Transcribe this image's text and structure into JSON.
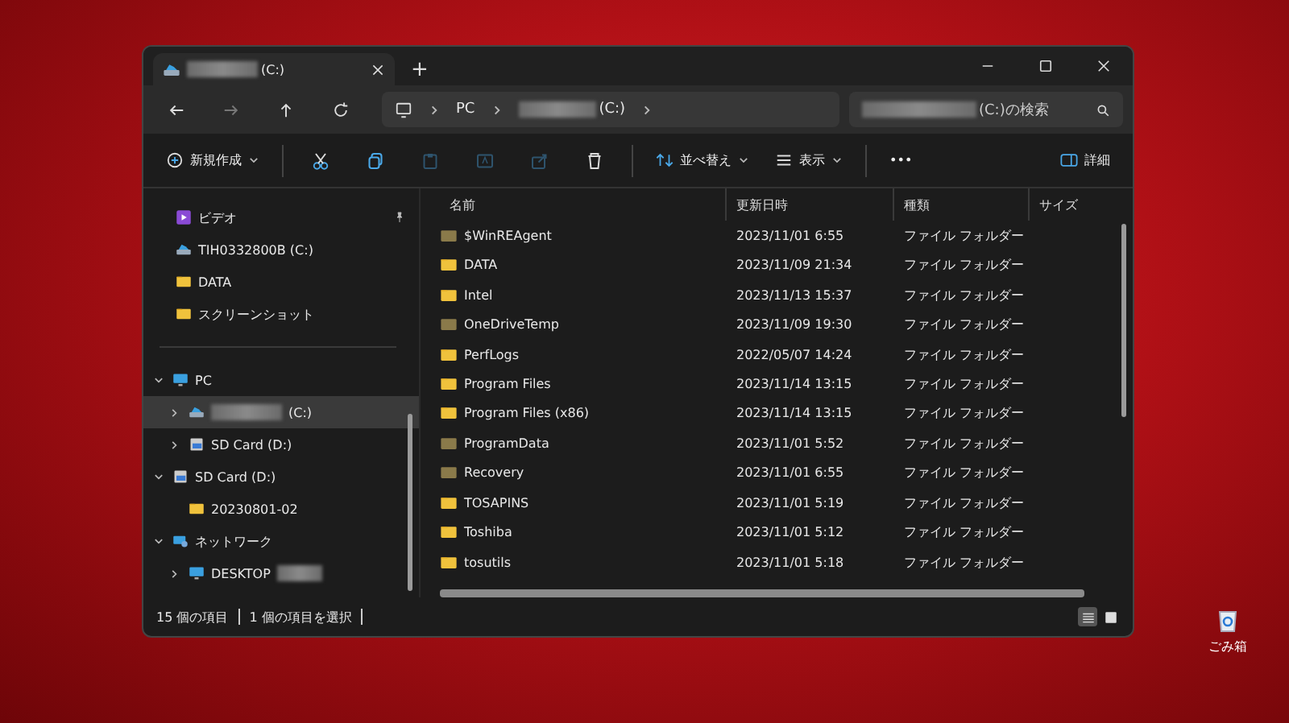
{
  "window": {
    "tab": {
      "title": "(C:)",
      "redacted": true
    },
    "new_tab": "+"
  },
  "address": {
    "crumbs": [
      {
        "label": "PC",
        "redacted": false
      },
      {
        "label": "(C:)",
        "redacted": true
      }
    ],
    "search": {
      "placeholder": "(C:)の検索",
      "redacted": true
    }
  },
  "toolbar": {
    "new": "新規作成",
    "actions": [
      {
        "kind": "cut",
        "disabled": false
      },
      {
        "kind": "copy",
        "disabled": false
      },
      {
        "kind": "paste",
        "disabled": true
      },
      {
        "kind": "rename",
        "disabled": true
      },
      {
        "kind": "share",
        "disabled": true
      },
      {
        "kind": "delete",
        "disabled": false
      }
    ],
    "sort": "並べ替え",
    "view": "表示",
    "more": "•••",
    "details": "詳細"
  },
  "sidebar": {
    "quick": [
      {
        "label": "ビデオ",
        "kind": "video",
        "pinned": true
      },
      {
        "label": "TIH0332800B (C:)",
        "kind": "drive",
        "pinned": false
      },
      {
        "label": "DATA",
        "kind": "folder",
        "pinned": false
      },
      {
        "label": "スクリーンショット",
        "kind": "folder",
        "pinned": false
      }
    ],
    "tree": [
      {
        "label": "PC",
        "kind": "pc",
        "expanded": true,
        "selected": false,
        "redacted": false,
        "children": [
          {
            "label": "(C:)",
            "kind": "drive",
            "expanded": false,
            "selected": true,
            "redacted": true
          },
          {
            "label": "SD Card (D:)",
            "kind": "sd",
            "expanded": false,
            "selected": false,
            "redacted": false
          }
        ]
      },
      {
        "label": "SD Card (D:)",
        "kind": "sd",
        "expanded": true,
        "selected": false,
        "redacted": false,
        "children": [
          {
            "label": "20230801-02",
            "kind": "folder",
            "selected": false,
            "redacted": false
          }
        ]
      },
      {
        "label": "ネットワーク",
        "kind": "network",
        "expanded": true,
        "selected": false,
        "redacted": false,
        "children": [
          {
            "label": "DESKTOP",
            "kind": "pc",
            "expanded": false,
            "selected": false,
            "redacted": true
          }
        ]
      }
    ]
  },
  "table": {
    "columns": [
      "名前",
      "更新日時",
      "種類",
      "サイズ"
    ],
    "rows": [
      {
        "name": "$WinREAgent",
        "date": "2023/11/01 6:55",
        "type": "ファイル フォルダー",
        "hidden": true
      },
      {
        "name": "DATA",
        "date": "2023/11/09 21:34",
        "type": "ファイル フォルダー",
        "hidden": false
      },
      {
        "name": "Intel",
        "date": "2023/11/13 15:37",
        "type": "ファイル フォルダー",
        "hidden": false
      },
      {
        "name": "OneDriveTemp",
        "date": "2023/11/09 19:30",
        "type": "ファイル フォルダー",
        "hidden": true
      },
      {
        "name": "PerfLogs",
        "date": "2022/05/07 14:24",
        "type": "ファイル フォルダー",
        "hidden": false
      },
      {
        "name": "Program Files",
        "date": "2023/11/14 13:15",
        "type": "ファイル フォルダー",
        "hidden": false
      },
      {
        "name": "Program Files (x86)",
        "date": "2023/11/14 13:15",
        "type": "ファイル フォルダー",
        "hidden": false
      },
      {
        "name": "ProgramData",
        "date": "2023/11/01 5:52",
        "type": "ファイル フォルダー",
        "hidden": true
      },
      {
        "name": "Recovery",
        "date": "2023/11/01 6:55",
        "type": "ファイル フォルダー",
        "hidden": true
      },
      {
        "name": "TOSAPINS",
        "date": "2023/11/01 5:19",
        "type": "ファイル フォルダー",
        "hidden": false
      },
      {
        "name": "Toshiba",
        "date": "2023/11/01 5:12",
        "type": "ファイル フォルダー",
        "hidden": false
      },
      {
        "name": "tosutils",
        "date": "2023/11/01 5:18",
        "type": "ファイル フォルダー",
        "hidden": false
      }
    ]
  },
  "status_bar": {
    "count": "15 個の項目",
    "selection": "1 個の項目を選択"
  },
  "desktop": {
    "icons": [
      {
        "label": "ごみ箱"
      }
    ]
  }
}
